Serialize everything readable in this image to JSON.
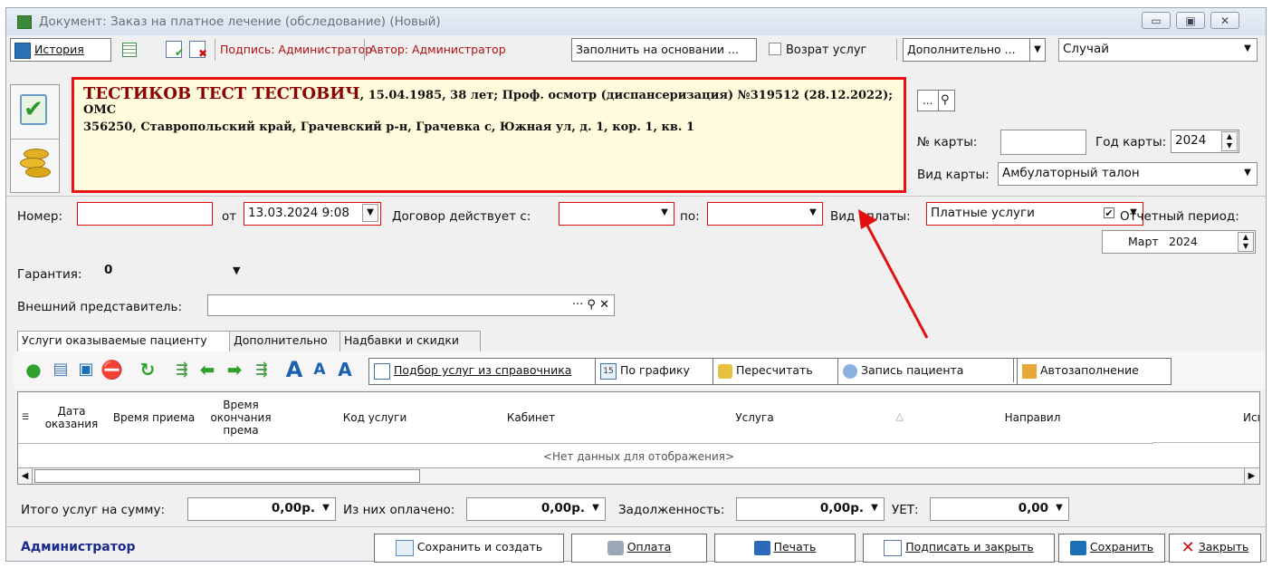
{
  "window": {
    "title": "Документ: Заказ на платное лечение (обследование) (Новый)",
    "btn_minimize": "▭",
    "btn_maximize": "▣",
    "btn_close": "✕"
  },
  "toolbar": {
    "history": "История",
    "signature": "Подпись: Администратор",
    "author": "Автор: Администратор",
    "fill_basis": "Заполнить на основании ...",
    "return_services": "Возрат услуг",
    "additional": "Дополнительно ...",
    "case": "Случай"
  },
  "patient": {
    "name": "ТЕСТИКОВ ТЕСТ ТЕСТОВИЧ",
    "details": ", 15.04.1985, 38 лет; Проф. осмотр (диспансеризация) №319512 (28.12.2022);",
    "insurance": "ОМС",
    "address": "356250, Ставропольский край, Грачевский р-н, Грачевка с, Южная ул, д. 1, кор. 1, кв. 1"
  },
  "card": {
    "browse": "...",
    "card_no_label": "№ карты:",
    "card_no": "",
    "card_year_label": "Год карты:",
    "card_year": "2024",
    "card_type_label": "Вид карты:",
    "card_type": "Амбулаторный талон"
  },
  "form": {
    "number_label": "Номер:",
    "number": "",
    "from_label": "от",
    "from_date": "13.03.2024 9:08",
    "contract_from_label": "Договор действует с:",
    "contract_from": "",
    "contract_to_label": "по:",
    "contract_to": "",
    "payment_type_label": "Вид оплаты:",
    "payment_type": "Платные услуги",
    "report_period_label": "Отчетный период:",
    "report_month": "Март",
    "report_year": "2024",
    "guarantee_label": "Гарантия:",
    "guarantee": "0",
    "ext_rep_label": "Внешний представитель:",
    "ext_rep": ""
  },
  "tabs": [
    "Услуги оказываемые пациенту",
    "Дополнительно",
    "Надбавки и скидки"
  ],
  "services_toolbar": {
    "select_from_ref": "Подбор услуг из справочника",
    "by_schedule": "По графику",
    "schedule_icon_num": "15",
    "recalculate": "Пересчитать",
    "patient_record": "Запись пациента",
    "autofill": "Автозаполнение"
  },
  "grid": {
    "columns": [
      "Дата оказания",
      "Время приема",
      "Время окончания према",
      "Код услуги",
      "Кабинет",
      "Услуга",
      "Направил",
      "Исполнитель"
    ],
    "empty_text": "<Нет данных для отображения>"
  },
  "totals": {
    "total_label": "Итого услуг на сумму:",
    "total": "0,00р.",
    "paid_label": "Из них оплачено:",
    "paid": "0,00р.",
    "debt_label": "Задолженность:",
    "debt": "0,00р.",
    "uet_label": "УЕТ:",
    "uet": "0,00"
  },
  "footer": {
    "user": "Администратор",
    "save_create": "Сохранить и создать",
    "payment": "Оплата",
    "print": "Печать",
    "sign_close": "Подписать и закрыть",
    "save": "Сохранить",
    "close": "Закрыть"
  },
  "colors": {
    "accent_red": "#e11111",
    "patient_name": "#8b0000",
    "user_blue": "#1a2a8a"
  }
}
